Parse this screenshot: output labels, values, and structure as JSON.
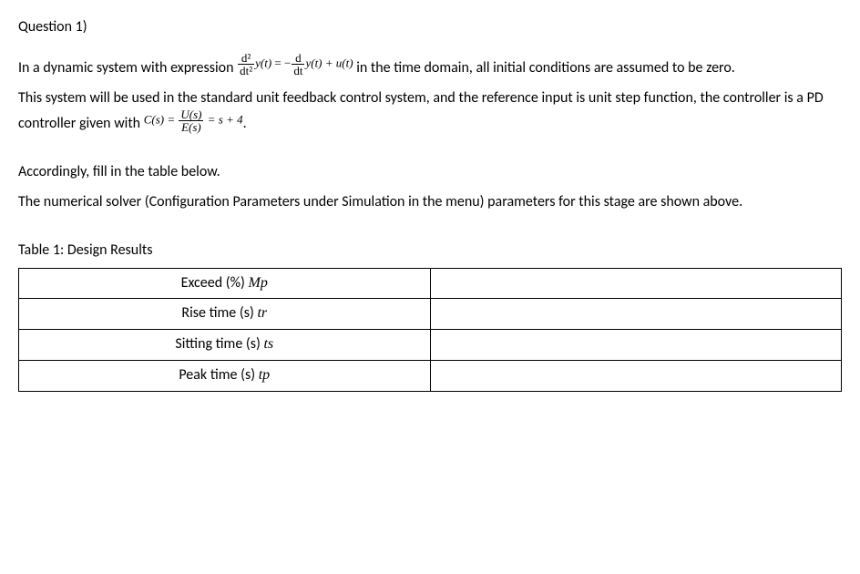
{
  "title": "Question 1)",
  "para1a": "In a dynamic system with expression ",
  "eq1": {
    "lhs_num": "d²",
    "lhs_den": "dt²",
    "lhs_sym": "y(t)",
    "eq": " = −",
    "rhs1_num": "d",
    "rhs1_den": "dt",
    "rhs1_sym": "y(t) + u(t)"
  },
  "para1b": " in the time domain, all initial conditions are assumed to be zero.",
  "para2": "This system will be used in the standard unit feedback control system, and the reference input is unit step function, the controller is a PD controller given with ",
  "eq2": {
    "csym": "C(s) = ",
    "num": "U(s)",
    "den": "E(s)",
    "eq": " = s + 4"
  },
  "para2b": ".",
  "para3": "Accordingly, fill in the table below.",
  "para4": "The numerical solver (Configuration Parameters under Simulation in the menu) parameters for this stage are shown above.",
  "table": {
    "caption": "Table 1: Design Results",
    "rows": [
      {
        "label": "Exceed (%)",
        "sym": "Mp",
        "value": ""
      },
      {
        "label": "Rise time (s)",
        "sym": "tr",
        "value": ""
      },
      {
        "label": "Sitting time (s)",
        "sym": "ts",
        "value": ""
      },
      {
        "label": "Peak time (s)",
        "sym": "tp",
        "value": ""
      }
    ]
  }
}
